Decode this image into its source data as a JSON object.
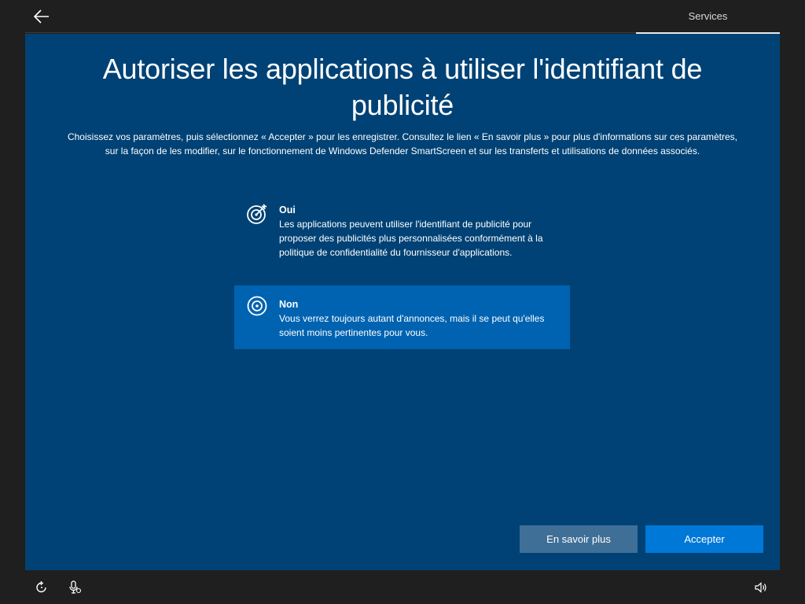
{
  "header": {
    "back_icon": "arrow-left-icon",
    "active_tab": "Services"
  },
  "main": {
    "title": "Autoriser les applications à utiliser l'identifiant de publicité",
    "description": "Choisissez vos paramètres, puis sélectionnez « Accepter » pour les enregistrer. Consultez le lien « En savoir plus » pour plus d'informations sur ces paramètres, sur la façon de les modifier, sur le fonctionnement de Windows Defender SmartScreen et sur les transferts et utilisations de données associés.",
    "options": [
      {
        "icon": "target-icon",
        "title": "Oui",
        "description": "Les applications peuvent utiliser l'identifiant de publicité pour proposer des publicités plus personnalisées conformément à la politique de confidentialité du fournisseur d'applications.",
        "selected": false
      },
      {
        "icon": "circle-target-icon",
        "title": "Non",
        "description": "Vous verrez toujours autant d'annonces, mais il se peut qu'elles soient moins pertinentes pour vous.",
        "selected": true
      }
    ],
    "buttons": {
      "learn_more": "En savoir plus",
      "accept": "Accepter"
    }
  },
  "footer": {
    "icons": [
      "ease-of-access-icon",
      "microphone-icon",
      "volume-icon"
    ]
  },
  "colors": {
    "panel": "#004275",
    "selected_option": "#0063b1",
    "accept_button": "#0078d7",
    "learn_button": "#3f6f97",
    "chrome": "#1f1f1f"
  }
}
